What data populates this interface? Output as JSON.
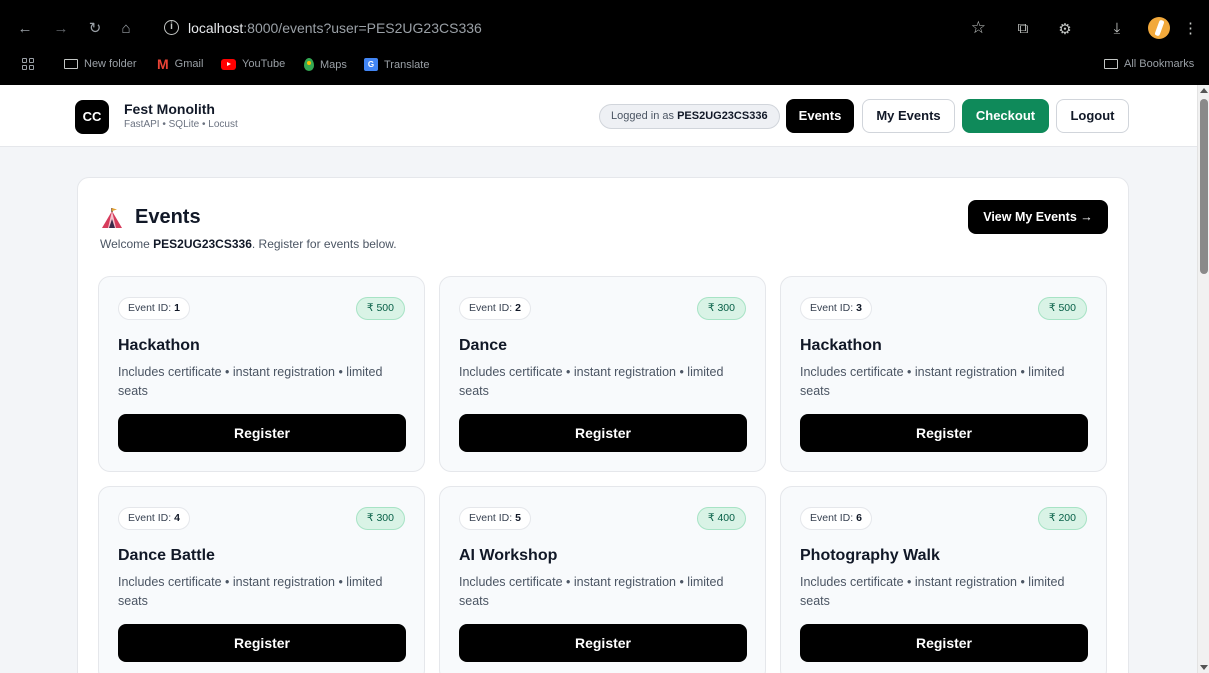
{
  "browser": {
    "url_prefix": "localhost",
    "url_rest": ":8000/events?user=PES2UG23CS336",
    "bookmarks": [
      {
        "label": "New folder",
        "icon": "folder-icon"
      },
      {
        "label": "Gmail",
        "icon": "gmail-icon"
      },
      {
        "label": "YouTube",
        "icon": "youtube-icon"
      },
      {
        "label": "Maps",
        "icon": "maps-icon"
      },
      {
        "label": "Translate",
        "icon": "translate-icon"
      }
    ],
    "all_bookmarks": "All Bookmarks"
  },
  "header": {
    "logo_text": "CC",
    "brand_title": "Fest Monolith",
    "brand_subtitle": "FastAPI • SQLite • Locust",
    "logged_in_prefix": "Logged in as",
    "logged_in_user": "PES2UG23CS336",
    "nav": {
      "events": "Events",
      "my_events": "My Events",
      "checkout": "Checkout",
      "logout": "Logout"
    }
  },
  "main": {
    "title": "Events",
    "welcome_prefix": "Welcome",
    "welcome_user": "PES2UG23CS336",
    "welcome_suffix": ". Register for events below.",
    "view_my_events": "View My Events →",
    "id_label": "Event ID:",
    "events": [
      {
        "id": "1",
        "price": "₹ 500",
        "title": "Hackathon",
        "desc": "Includes certificate • instant registration • limited seats",
        "button": "Register"
      },
      {
        "id": "2",
        "price": "₹ 300",
        "title": "Dance",
        "desc": "Includes certificate • instant registration • limited seats",
        "button": "Register"
      },
      {
        "id": "3",
        "price": "₹ 500",
        "title": "Hackathon",
        "desc": "Includes certificate • instant registration • limited seats",
        "button": "Register"
      },
      {
        "id": "4",
        "price": "₹ 300",
        "title": "Dance Battle",
        "desc": "Includes certificate • instant registration • limited seats",
        "button": "Register"
      },
      {
        "id": "5",
        "price": "₹ 400",
        "title": "AI Workshop",
        "desc": "Includes certificate • instant registration • limited seats",
        "button": "Register"
      },
      {
        "id": "6",
        "price": "₹ 200",
        "title": "Photography Walk",
        "desc": "Includes certificate • instant registration • limited seats",
        "button": "Register"
      }
    ]
  },
  "colors": {
    "primary": "#000000",
    "checkout_green": "#0f8a5a",
    "price_badge_bg": "#d9f3e6",
    "page_bg": "#f3f5f8"
  }
}
